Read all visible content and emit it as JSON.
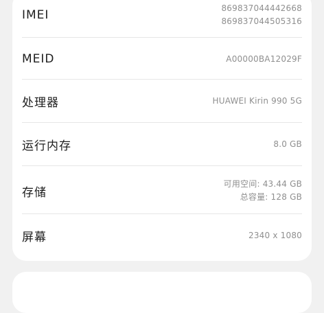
{
  "about_phone": {
    "imei": {
      "label": "IMEI",
      "values": [
        "869837044442668",
        "869837044505316"
      ]
    },
    "meid": {
      "label": "MEID",
      "value": "A00000BA12029F"
    },
    "processor": {
      "label": "处理器",
      "value": "HUAWEI Kirin 990 5G"
    },
    "ram": {
      "label": "运行内存",
      "value": "8.0 GB"
    },
    "storage": {
      "label": "存储",
      "available": "可用空间: 43.44 GB",
      "total": "总容量: 128 GB"
    },
    "screen": {
      "label": "屏幕",
      "value": "2340 x 1080"
    }
  }
}
